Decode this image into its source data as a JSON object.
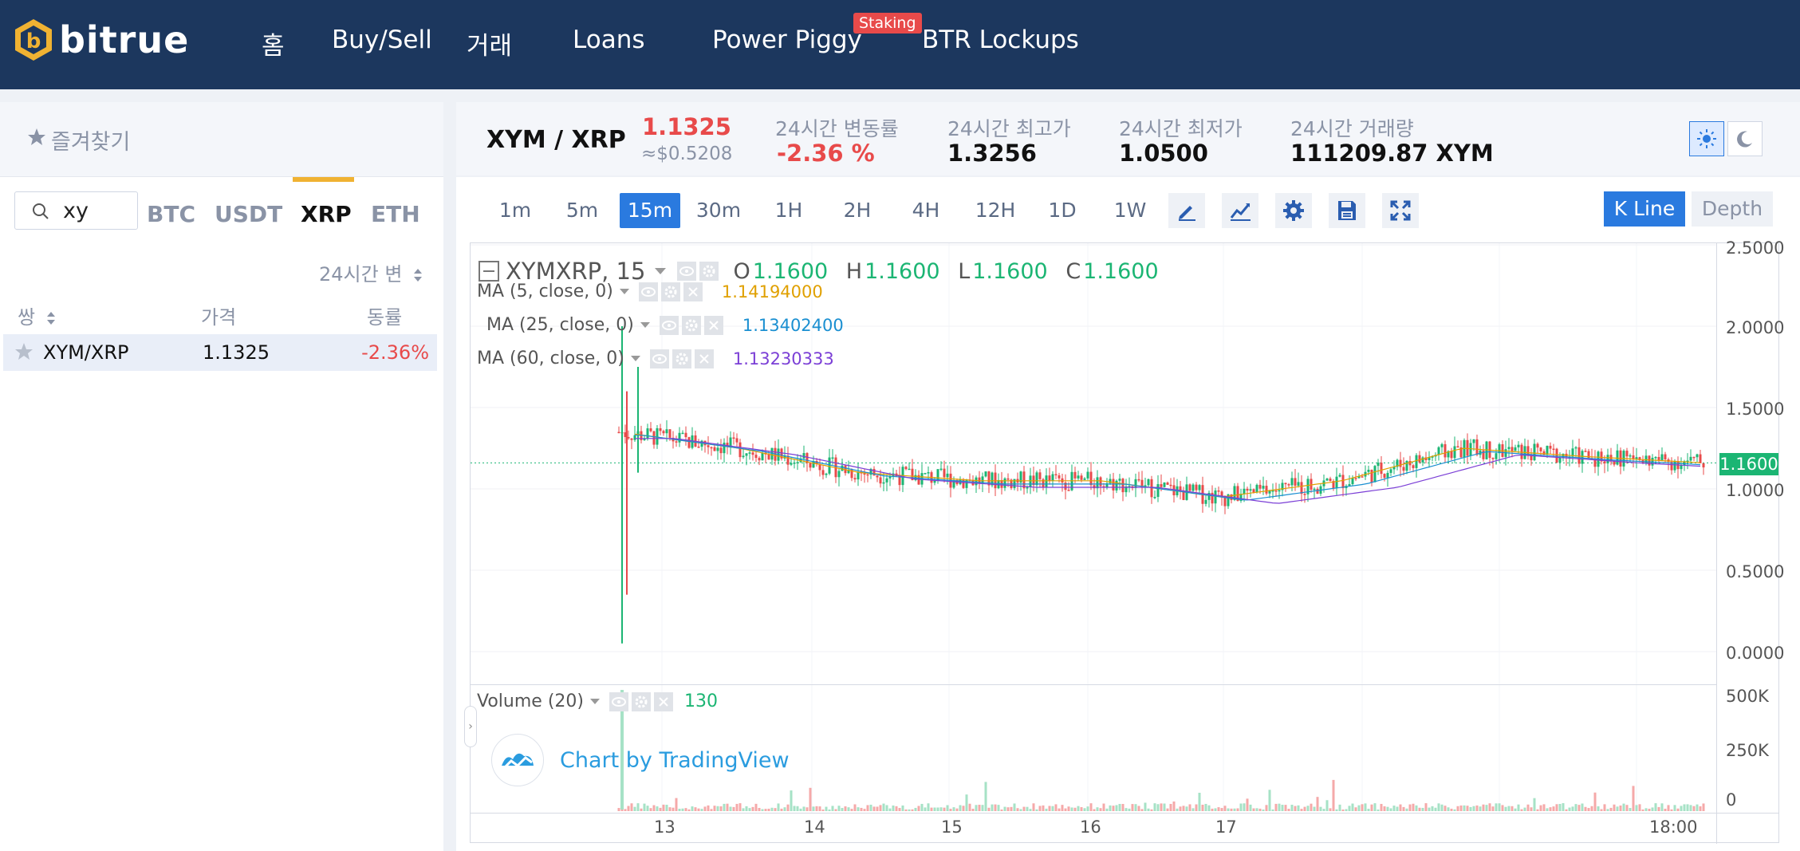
{
  "brand": {
    "name": "bitrue"
  },
  "nav": {
    "items": [
      "홈",
      "Buy/Sell",
      "거래",
      "Loans",
      "Power Piggy",
      "BTR Lockups"
    ],
    "badge": "Staking"
  },
  "sidebar": {
    "favorites_label": "즐겨찾기",
    "search": {
      "value": "xy"
    },
    "markets": [
      "BTC",
      "USDT",
      "XRP",
      "ETH"
    ],
    "active_market": "XRP",
    "sort_label": "24시간 변",
    "columns": {
      "pair": "쌍",
      "price": "가격",
      "change": "동률"
    },
    "rows": [
      {
        "pair": "XYM/XRP",
        "price": "1.1325",
        "change": "-2.36%"
      }
    ]
  },
  "ticker": {
    "pair": "XYM / XRP",
    "price": "1.1325",
    "usd": "≈$0.5208",
    "change_label": "24시간 변동률",
    "change_value": "-2.36 %",
    "high_label": "24시간 최고가",
    "high_value": "1.3256",
    "low_label": "24시간 최저가",
    "low_value": "1.0500",
    "volume_label": "24시간 거래량",
    "volume_value": "111209.87 XYM"
  },
  "toolbar": {
    "timeframes": [
      "1m",
      "5m",
      "15m",
      "30m",
      "1H",
      "2H",
      "4H",
      "12H",
      "1D",
      "1W"
    ],
    "active_timeframe": "15m",
    "kline_label": "K Line",
    "depth_label": "Depth"
  },
  "chart": {
    "symbol": "XYMXRP",
    "interval": "15",
    "ohlc": {
      "O": "1.1600",
      "H": "1.1600",
      "L": "1.1600",
      "C": "1.1600"
    },
    "ma": [
      {
        "label": "MA (5, close, 0)",
        "value": "1.14194000",
        "color": "#e0a000"
      },
      {
        "label": "MA (25, close, 0)",
        "value": "1.13402400",
        "color": "#1a8fd1"
      },
      {
        "label": "MA (60, close, 0)",
        "value": "1.13230333",
        "color": "#7b3fd6"
      }
    ],
    "last_price": "1.1600",
    "volume_label": "Volume (20)",
    "volume_value": "130",
    "watermark": "Chart by TradingView",
    "colors": {
      "up": "#1bb573",
      "down": "#e84a4a"
    }
  },
  "chart_data": {
    "type": "line",
    "title": "XYMXRP, 15",
    "x_tick_labels": [
      "13",
      "14",
      "15",
      "16",
      "17",
      "18:00"
    ],
    "y_tick_labels": [
      "0.0000",
      "0.5000",
      "1.0000",
      "1.5000",
      "2.0000",
      "2.5000"
    ],
    "ylim": [
      0,
      2.5
    ],
    "volume_tick_labels": [
      "0",
      "250K",
      "500K"
    ],
    "series": [
      {
        "name": "XYMXRP",
        "x": [
          "13",
          "13.5",
          "14",
          "14.5",
          "15",
          "15.5",
          "16",
          "16.5",
          "17",
          "18:00"
        ],
        "values": [
          1.35,
          1.25,
          1.1,
          1.05,
          1.05,
          0.95,
          1.05,
          1.25,
          1.2,
          1.16
        ]
      }
    ]
  }
}
